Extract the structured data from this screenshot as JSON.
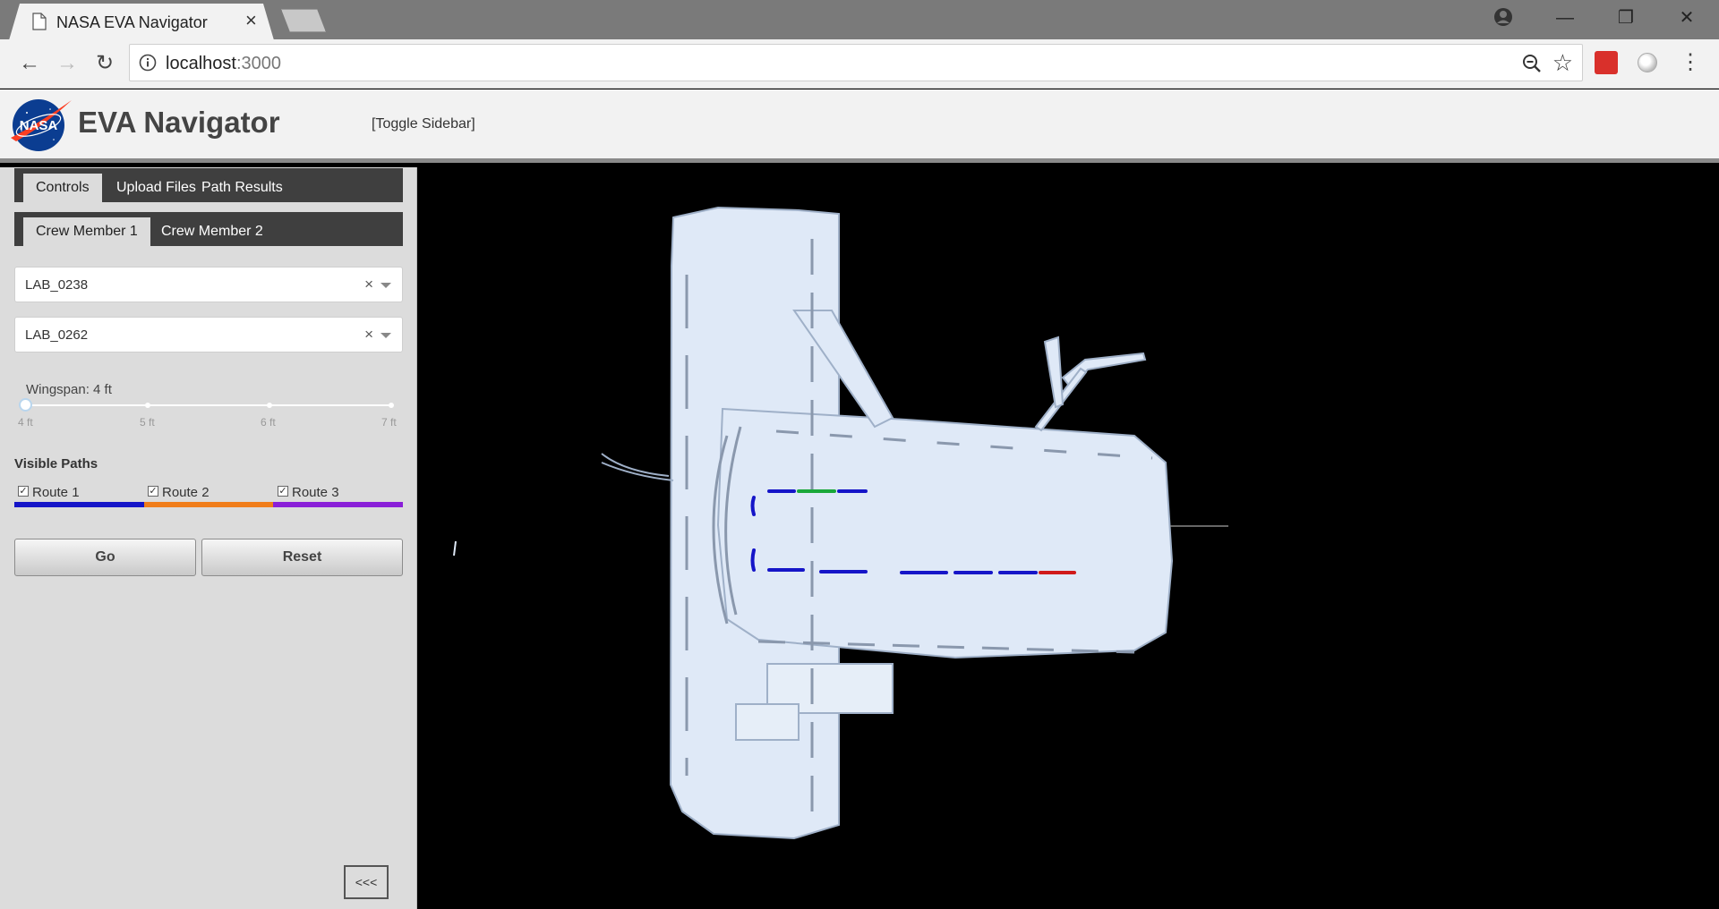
{
  "browser": {
    "tab_title": "NASA EVA Navigator",
    "tab_close": "×",
    "url_host": "localhost",
    "url_port": ":3000",
    "back_icon": "←",
    "forward_icon": "→",
    "reload_icon": "↻",
    "star_icon": "☆",
    "menu_icon": "⋮",
    "minimize_icon": "—",
    "restore_icon": "❐",
    "close_icon": "✕"
  },
  "header": {
    "title": "EVA Navigator",
    "toggle_sidebar": "[Toggle Sidebar]",
    "logo_text": "NASA"
  },
  "sidebar": {
    "main_tabs": [
      {
        "label": "Controls",
        "active": true
      },
      {
        "label": "Upload Files",
        "active": false
      },
      {
        "label": "Path Results",
        "active": false
      }
    ],
    "crew_tabs": [
      {
        "label": "Crew Member 1",
        "active": true
      },
      {
        "label": "Crew Member 2",
        "active": false
      }
    ],
    "start_select": {
      "value": "LAB_0238",
      "clear": "×"
    },
    "end_select": {
      "value": "LAB_0262",
      "clear": "×"
    },
    "wingspan": {
      "label": "Wingspan: 4 ft",
      "value_ft": 4,
      "min_ft": 4,
      "max_ft": 7,
      "ticks": [
        "4 ft",
        "5 ft",
        "6 ft",
        "7 ft"
      ]
    },
    "visible_paths_heading": "Visible Paths",
    "routes": [
      {
        "label": "Route 1",
        "checked": true,
        "color": "#1515c8"
      },
      {
        "label": "Route 2",
        "checked": true,
        "color": "#f07d1a"
      },
      {
        "label": "Route 3",
        "checked": true,
        "color": "#8a1fd8"
      }
    ],
    "checkmark": "✓",
    "go_label": "Go",
    "reset_label": "Reset",
    "collapse_label": "<<<"
  },
  "viewport": {
    "background": "#000000",
    "model_color": "#dfe9f7",
    "path_colors": {
      "route1": "#1515c8",
      "green": "#1aa83a",
      "red": "#d01a1a"
    }
  }
}
